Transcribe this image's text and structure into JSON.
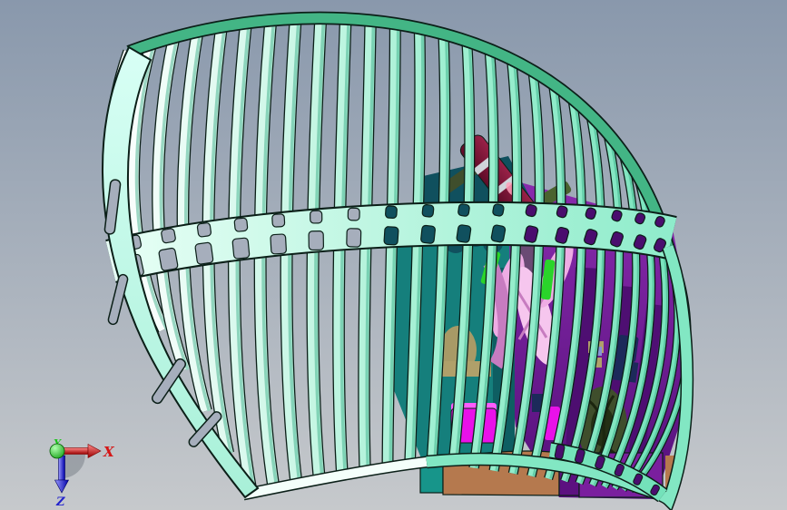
{
  "viewport": {
    "kind": "3d-cad-part-view"
  },
  "background": {
    "top": "#8998ac",
    "bottom": "#c6c9cc",
    "hole": "#a6aebc"
  },
  "triad": {
    "x": {
      "label": "X",
      "color": "#d51616",
      "hi": "#ff8a8a",
      "lo": "#9a0000"
    },
    "y": {
      "label": "Y",
      "color": "#17c417",
      "hi": "#b0ffb0",
      "lo": "#0a9a0a"
    },
    "z": {
      "label": "Z",
      "color": "#2222cc",
      "hi": "#9a9aff",
      "lo": "#0000a8"
    },
    "origin_color": "#22d422",
    "shadow_color": "#979ca3"
  },
  "model": {
    "colors": {
      "outline": "#0b1f18",
      "slat_left": "#ffffff",
      "slat_mid": "#a0f0d2",
      "slat_right": "#74e2ba",
      "slat_edge": "#2fa880",
      "rim_top": "#43b585",
      "rim_bottom_left": "#f4fffb",
      "rim_bottom_right": "#82e7c3",
      "band_light": "#e8fff6",
      "band_dark": "#8feccb",
      "panel_light": "#d8fff5",
      "panel_dark": "#a8f0d8",
      "interior_teal": "#157f7c",
      "interior_teal_dark": "#0e5e62",
      "interior_slate": "#10505e",
      "purple": "#7a1f9e",
      "purple_hi": "#8a2bae",
      "purple_mid": "#5c1180",
      "purple_lo": "#54107a",
      "purple_dark": "#4a0d6e",
      "maroon": "#8c1a40",
      "maroon_hi": "#9a2148",
      "maroon_dark": "#5e0c28",
      "pink": "#eeace4",
      "pink_light": "#f6c6ee",
      "pink_dark": "#c77cc0",
      "magenta": "#e911e9",
      "magenta_light": "#ff5cff",
      "green": "#2ad42a",
      "khaki": "#a89a66",
      "tan": "#b0a06a",
      "sienna": "#b5794e",
      "olive": "#3f4e2c",
      "olive_dark": "#242f15",
      "olive_lite": "#4a6330",
      "navy": "#1c2a5a",
      "periwinkle": "#8892d8",
      "base_teal": "#17958a",
      "sage": "#9cb392",
      "steel": "#cfd4da",
      "mauve": "#6a4a74",
      "highlight_pink": "#ff9fb8"
    }
  }
}
